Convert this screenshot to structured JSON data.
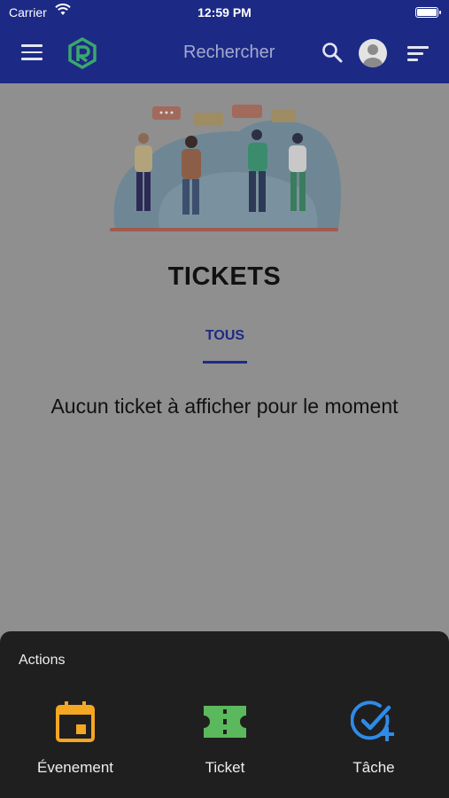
{
  "status_bar": {
    "carrier": "Carrier",
    "time": "12:59 PM"
  },
  "app_bar": {
    "search_label": "Rechercher"
  },
  "page": {
    "title": "TICKETS",
    "tabs": [
      {
        "label": "TOUS",
        "active": true
      }
    ],
    "empty_message": "Aucun ticket à afficher pour le moment"
  },
  "actions": {
    "heading": "Actions",
    "items": [
      {
        "label": "Évenement",
        "icon": "calendar-icon",
        "color": "#f5a623"
      },
      {
        "label": "Ticket",
        "icon": "ticket-icon",
        "color": "#5cb85c"
      },
      {
        "label": "Tâche",
        "icon": "task-check-icon",
        "color": "#2f8be8"
      }
    ]
  },
  "colors": {
    "primary": "#1c2a86",
    "overlay_bg": "#8f8f8f",
    "sheet_bg": "#1f1f1f"
  }
}
